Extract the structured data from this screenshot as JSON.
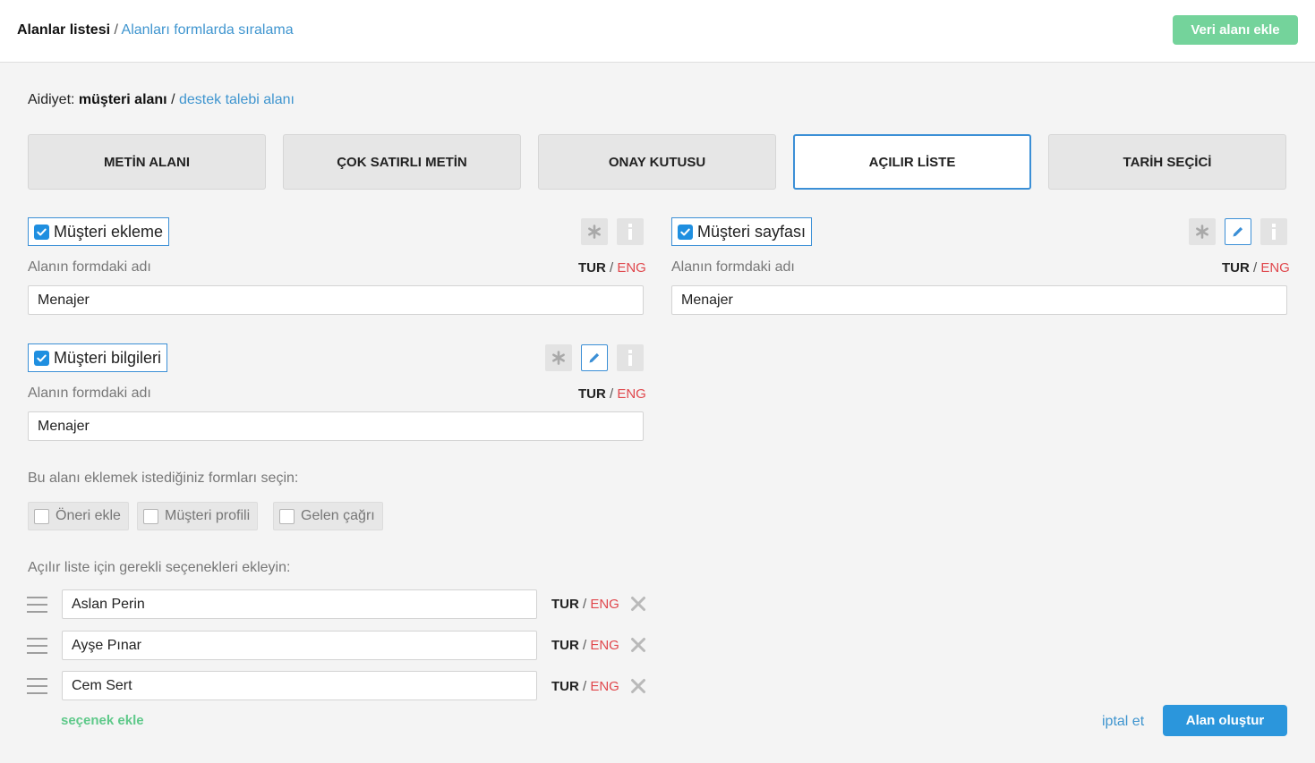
{
  "breadcrumb": {
    "current": "Alanlar listesi",
    "separator": "/",
    "link": "Alanları formlarda sıralama"
  },
  "header": {
    "add_button": "Veri alanı ekle"
  },
  "owner": {
    "prefix": "Aidiyet:",
    "active": "müşteri alanı",
    "separator": "/",
    "link": "destek talebi alanı"
  },
  "tabs": [
    {
      "label": "METİN ALANI",
      "active": false
    },
    {
      "label": "ÇOK SATIRLI METİN",
      "active": false
    },
    {
      "label": "ONAY KUTUSU",
      "active": false
    },
    {
      "label": "AÇILIR LİSTE",
      "active": true
    },
    {
      "label": "TARİH SEÇİCİ",
      "active": false
    }
  ],
  "sections": [
    {
      "checkbox_label": "Müşteri ekleme",
      "checked": true,
      "field_label": "Alanın formdaki adı",
      "lang_tur": "TUR",
      "lang_sep": "/",
      "lang_eng": "ENG",
      "value": "Menajer"
    },
    {
      "checkbox_label": "Müşteri sayfası",
      "checked": true,
      "field_label": "Alanın formdaki adı",
      "lang_tur": "TUR",
      "lang_sep": "/",
      "lang_eng": "ENG",
      "value": "Menajer"
    },
    {
      "checkbox_label": "Müşteri bilgileri",
      "checked": true,
      "field_label": "Alanın formdaki adı",
      "lang_tur": "TUR",
      "lang_sep": "/",
      "lang_eng": "ENG",
      "value": "Menajer"
    }
  ],
  "forms": {
    "prompt": "Bu alanı eklemek istediğiniz formları seçin:",
    "items": [
      {
        "label": "Öneri ekle",
        "checked": false
      },
      {
        "label": "Müşteri profili",
        "checked": false
      },
      {
        "label": "Gelen çağrı",
        "checked": false
      }
    ]
  },
  "options": {
    "prompt": "Açılır liste için gerekli seçenekleri ekleyin:",
    "items": [
      {
        "value": "Aslan Perin",
        "lang_tur": "TUR",
        "lang_sep": "/",
        "lang_eng": "ENG"
      },
      {
        "value": "Ayşe Pınar",
        "lang_tur": "TUR",
        "lang_sep": "/",
        "lang_eng": "ENG"
      },
      {
        "value": "Cem Sert",
        "lang_tur": "TUR",
        "lang_sep": "/",
        "lang_eng": "ENG"
      }
    ],
    "add_label": "seçenek ekle"
  },
  "footer": {
    "cancel": "iptal et",
    "submit": "Alan oluştur"
  },
  "colors": {
    "accent_blue": "#2b96dc",
    "accent_green": "#74d39b",
    "eng_red": "#e0474c",
    "link_blue": "#3f95cf"
  }
}
